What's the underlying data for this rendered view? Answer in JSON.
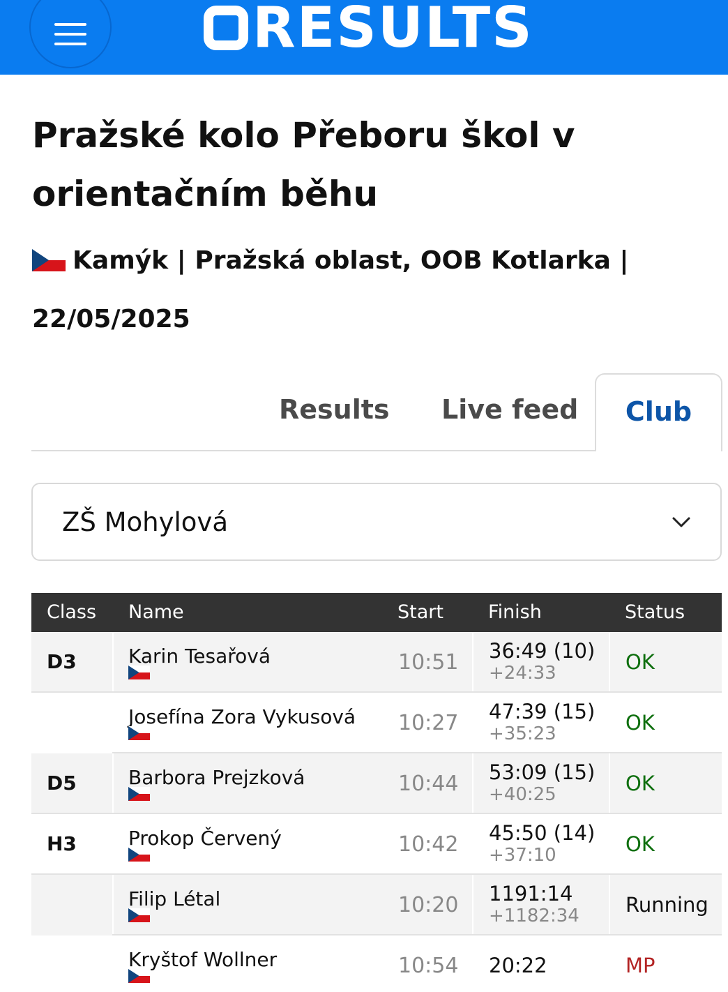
{
  "header": {
    "logo_text": "RESULTS",
    "brand_color": "#0a7cf0"
  },
  "event": {
    "title": "Pražské kolo Přeboru škol v orientačním běhu",
    "location": "Kamýk | Pražská oblast, OOB Kotlarka |",
    "date": "22/05/2025"
  },
  "tabs": [
    {
      "label": "Results",
      "active": false
    },
    {
      "label": "Live feed",
      "active": false
    },
    {
      "label": "Club",
      "active": true
    }
  ],
  "club_select": {
    "value": "ZŠ Mohylová"
  },
  "table": {
    "headers": [
      "Class",
      "Name",
      "Start",
      "Finish",
      "Status"
    ],
    "rows": [
      {
        "class": "D3",
        "name": "Karin Tesařová",
        "start": "10:51",
        "finish": "36:49 (10)",
        "diff": "+24:33",
        "status": "OK"
      },
      {
        "class": "",
        "name": "Josefína Zora Vykusová",
        "start": "10:27",
        "finish": "47:39 (15)",
        "diff": "+35:23",
        "status": "OK"
      },
      {
        "class": "D5",
        "name": "Barbora Prejzková",
        "start": "10:44",
        "finish": "53:09 (15)",
        "diff": "+40:25",
        "status": "OK"
      },
      {
        "class": "H3",
        "name": "Prokop Červený",
        "start": "10:42",
        "finish": "45:50 (14)",
        "diff": "+37:10",
        "status": "OK"
      },
      {
        "class": "",
        "name": "Filip Létal",
        "start": "10:20",
        "finish": "1191:14",
        "diff": "+1182:34",
        "status": "Running"
      },
      {
        "class": "",
        "name": "Kryštof Wollner",
        "start": "10:54",
        "finish": "20:22",
        "diff": "",
        "status": "MP"
      }
    ]
  },
  "status_colors": {
    "OK": "#0d6e0d",
    "Running": "#111111",
    "MP": "#b32424"
  },
  "icons": {
    "menu": "hamburger-icon",
    "dropdown": "chevron-down-icon",
    "flag": "czech-flag-icon"
  }
}
